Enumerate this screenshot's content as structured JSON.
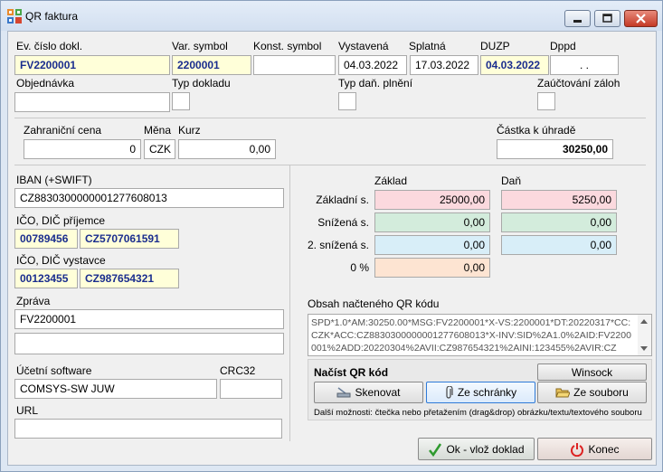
{
  "window": {
    "title": "QR faktura"
  },
  "header": {
    "ev_cislo_label": "Ev. číslo dokl.",
    "ev_cislo_value": "FV2200001",
    "var_symbol_label": "Var. symbol",
    "var_symbol_value": "2200001",
    "konst_symbol_label": "Konst. symbol",
    "konst_symbol_value": "",
    "vystavena_label": "Vystavená",
    "vystavena_value": "04.03.2022",
    "splatna_label": "Splatná",
    "splatna_value": "17.03.2022",
    "duzp_label": "DUZP",
    "duzp_value": "04.03.2022",
    "dppd_label": "Dppd",
    "dppd_value": " .  .",
    "objednavka_label": "Objednávka",
    "objednavka_value": "",
    "typ_dokladu_label": "Typ dokladu",
    "typ_dan_plneni_label": "Typ daň. plnění",
    "zauctovani_zaloh_label": "Zaúčtování záloh"
  },
  "price": {
    "zahranicni_cena_label": "Zahraniční cena",
    "zahranicni_cena_value": "0",
    "mena_label": "Měna",
    "mena_value": "CZK",
    "kurz_label": "Kurz",
    "kurz_value": "0,00",
    "castka_label": "Částka k úhradě",
    "castka_value": "30250,00"
  },
  "left": {
    "iban_label": "IBAN (+SWIFT)",
    "iban_value": "CZ8830300000001277608013",
    "ico_prijemce_label": "IČO, DIČ příjemce",
    "ico_prijemce_value": "00789456",
    "dic_prijemce_value": "CZ5707061591",
    "ico_vystavce_label": "IČO, DIČ vystavce",
    "ico_vystavce_value": "00123455",
    "dic_vystavce_value": "CZ987654321",
    "zprava_label": "Zpráva",
    "zprava_value": "FV2200001",
    "zprava2_value": "",
    "ucetni_sw_label": "Účetní software",
    "ucetni_sw_value": "COMSYS-SW JUW",
    "crc_label": "CRC32",
    "crc_value": "",
    "url_label": "URL",
    "url_value": ""
  },
  "tax": {
    "zaklad_header": "Základ",
    "dan_header": "Daň",
    "rows": [
      {
        "label": "Základní s.",
        "zaklad": "25000,00",
        "dan": "5250,00"
      },
      {
        "label": "Snížená s.",
        "zaklad": "0,00",
        "dan": "0,00"
      },
      {
        "label": "2. snížená s.",
        "zaklad": "0,00",
        "dan": "0,00"
      },
      {
        "label": "0 %",
        "zaklad": "0,00"
      }
    ]
  },
  "qr": {
    "obsah_label": "Obsah načteného QR kódu",
    "content": "SPD*1.0*AM:30250.00*MSG:FV2200001*X-VS:2200001*DT:20220317*CC:CZK*ACC:CZ8830300000001277608013*X-INV:SID%2A1.0%2AID:FV2200001%2ADD:20220304%2AVII:CZ987654321%2AINI:123455%2AVIR:CZ",
    "nacist_label": "Načíst QR kód",
    "winsock_label": "Winsock",
    "skenovat_label": "Skenovat",
    "ze_schranky_label": "Ze schránky",
    "ze_souboru_label": "Ze souboru",
    "note": "Další možnosti: čtečka nebo přetažením (drag&drop) obrázku/textu/textového souboru"
  },
  "footer": {
    "ok_label": "Ok - vlož doklad",
    "konec_label": "Konec"
  },
  "colors": {
    "yellow_field": "#ffffd9",
    "pink_field": "#fbd9de",
    "green_field": "#d3ecdc",
    "blue_field": "#d8eef8",
    "peach_field": "#fde4d2",
    "accent_text": "#1a2d8e"
  }
}
